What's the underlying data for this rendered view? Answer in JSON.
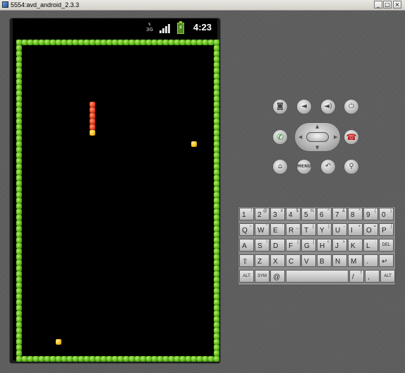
{
  "window": {
    "title": "5554:avd_android_2.3.3",
    "controls": {
      "minimize": "_",
      "maximize": "□",
      "close": "×"
    }
  },
  "status_bar": {
    "network": "3G",
    "clock": "4:23",
    "icons": [
      "network-3g-icon",
      "signal-strength-icon",
      "battery-charging-icon"
    ]
  },
  "game": {
    "name": "snake",
    "board_cols": 36,
    "board_rows": 57,
    "colors": {
      "wall": "#58b418",
      "snake_body": "#e03818",
      "snake_head": "#f2b90e",
      "apple": "#f2b90e",
      "background": "#000000"
    },
    "snake": [
      [
        13,
        11
      ],
      [
        13,
        12
      ],
      [
        13,
        13
      ],
      [
        13,
        14
      ],
      [
        13,
        15
      ],
      [
        13,
        16
      ]
    ],
    "apples": [
      [
        31,
        18
      ],
      [
        7,
        53
      ]
    ]
  },
  "hardware_buttons": {
    "row1": [
      "camera-icon",
      "volume-down-icon",
      "volume-up-icon",
      "power-icon"
    ],
    "row2": [
      "call-icon",
      "dpad",
      "end-call-icon"
    ],
    "row3": [
      "home-icon",
      "menu-button",
      "back-icon",
      "search-icon"
    ],
    "menu_label": "MENU"
  },
  "keyboard": {
    "rows": [
      [
        {
          "k": "1",
          "a": "!"
        },
        {
          "k": "2",
          "a": "@"
        },
        {
          "k": "3",
          "a": "#"
        },
        {
          "k": "4",
          "a": "$"
        },
        {
          "k": "5",
          "a": "%"
        },
        {
          "k": "6",
          "a": "^"
        },
        {
          "k": "7",
          "a": "&"
        },
        {
          "k": "8",
          "a": "*"
        },
        {
          "k": "9",
          "a": "("
        },
        {
          "k": "0",
          "a": ")"
        }
      ],
      [
        {
          "k": "Q",
          "a": "~"
        },
        {
          "k": "W",
          "a": "\""
        },
        {
          "k": "E",
          "a": "'"
        },
        {
          "k": "R",
          "a": "_"
        },
        {
          "k": "T",
          "a": "{"
        },
        {
          "k": "Y",
          "a": "}"
        },
        {
          "k": "U",
          "a": "-"
        },
        {
          "k": "I",
          "a": "+"
        },
        {
          "k": "O",
          "a": "="
        },
        {
          "k": "P",
          "a": "|"
        }
      ],
      [
        {
          "k": "A",
          "a": "`"
        },
        {
          "k": "S",
          "a": "\\"
        },
        {
          "k": "D",
          "a": ""
        },
        {
          "k": "F",
          "a": "["
        },
        {
          "k": "G",
          "a": "]"
        },
        {
          "k": "H",
          "a": "<"
        },
        {
          "k": "J",
          "a": ">"
        },
        {
          "k": "K",
          "a": ";"
        },
        {
          "k": "L",
          "a": ":"
        },
        {
          "k": "DEL",
          "a": ""
        }
      ],
      [
        {
          "k": "⇧",
          "a": ""
        },
        {
          "k": "Z",
          "a": ""
        },
        {
          "k": "X",
          "a": ""
        },
        {
          "k": "C",
          "a": ""
        },
        {
          "k": "V",
          "a": ""
        },
        {
          "k": "B",
          "a": ""
        },
        {
          "k": "N",
          "a": ""
        },
        {
          "k": "M",
          "a": ""
        },
        {
          "k": ".",
          "a": ""
        },
        {
          "k": "↵",
          "a": ""
        }
      ],
      [
        {
          "k": "ALT",
          "a": ""
        },
        {
          "k": "SYM",
          "a": ""
        },
        {
          "k": "@",
          "a": ""
        },
        {
          "k": "",
          "a": ""
        },
        {
          "k": "/",
          "a": "?"
        },
        {
          "k": ",",
          "a": ""
        },
        {
          "k": "ALT",
          "a": ""
        }
      ]
    ]
  }
}
